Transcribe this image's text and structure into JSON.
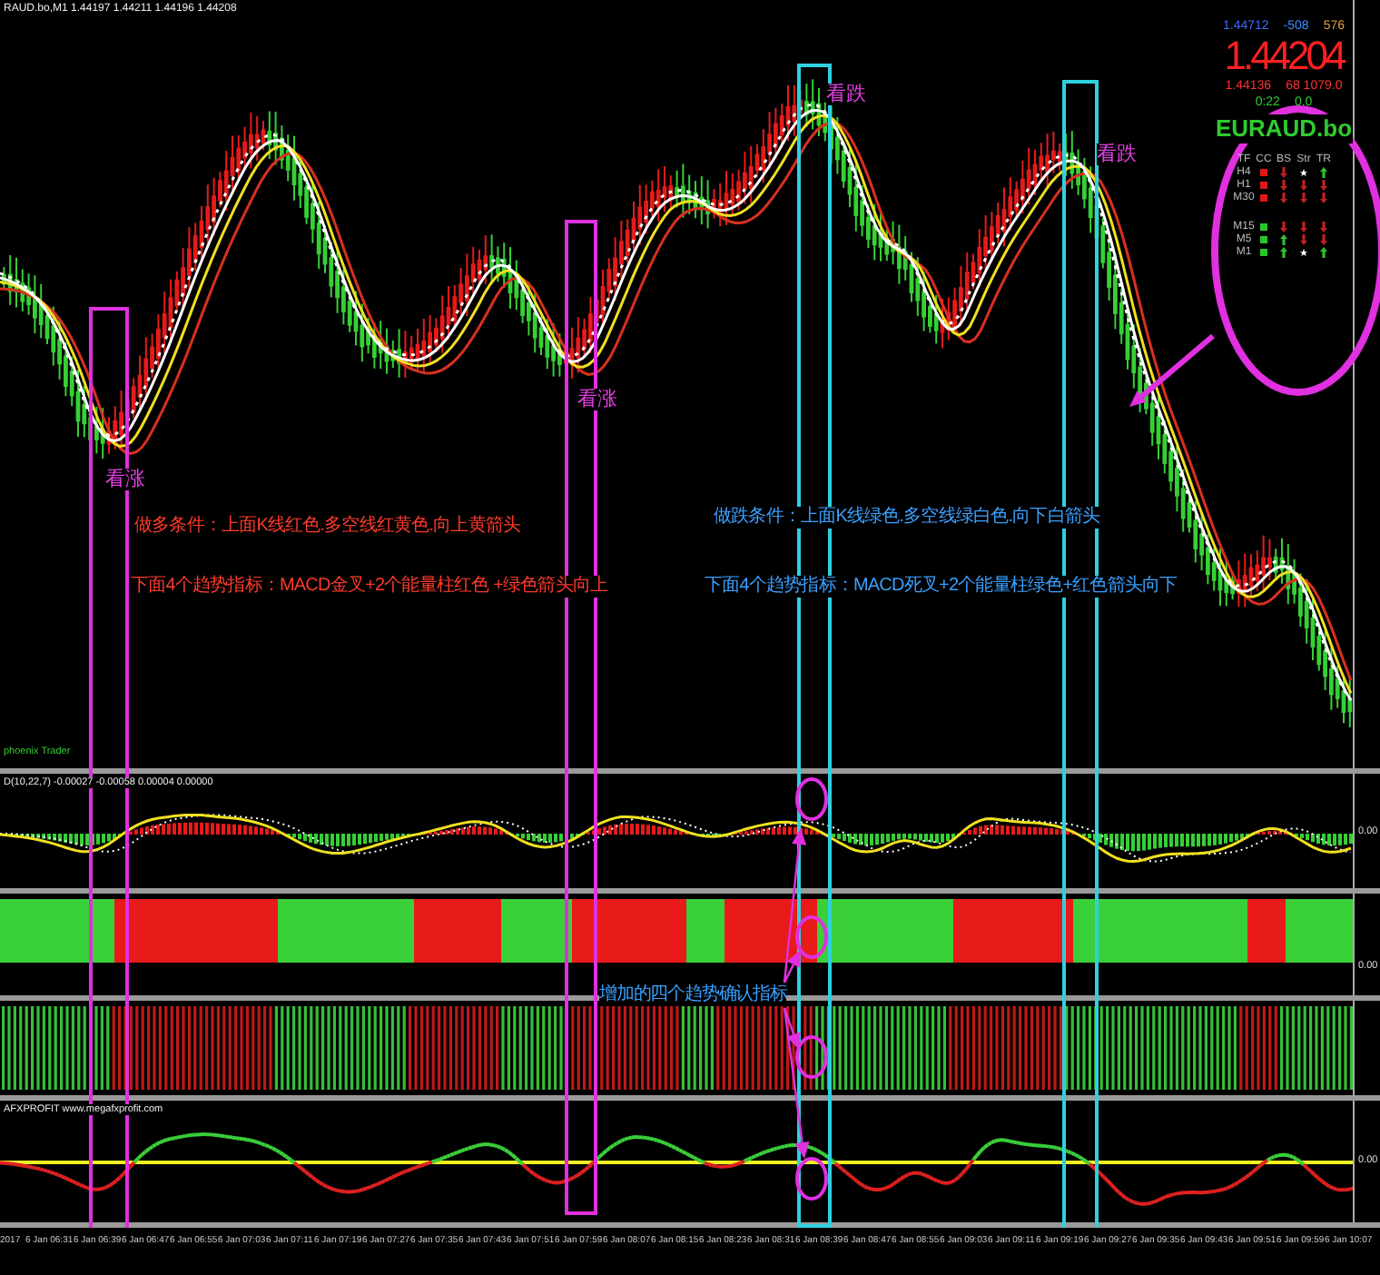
{
  "chart_header": {
    "title": "RAUD.bo,M1  1.44197 1.44211 1.44196 1.44208"
  },
  "info_panel": {
    "bid": "1.44712",
    "spread": "-508",
    "ticks": "576",
    "price": "1.44204",
    "low": "1.44136",
    "range": "68 1079.0",
    "timer": "0:22",
    "change": "0.0",
    "symbol": "EURAUD.bo",
    "columns": [
      "TF",
      "CC",
      "BS",
      "Str",
      "TR"
    ],
    "row_groups": [
      [
        {
          "tf": "H4",
          "cells": [
            {
              "kind": "square",
              "color": "#e01818"
            },
            {
              "kind": "down"
            },
            {
              "kind": "star"
            },
            {
              "kind": "up"
            }
          ]
        },
        {
          "tf": "H1",
          "cells": [
            {
              "kind": "square",
              "color": "#e01818"
            },
            {
              "kind": "down"
            },
            {
              "kind": "down"
            },
            {
              "kind": "down"
            }
          ]
        },
        {
          "tf": "M30",
          "cells": [
            {
              "kind": "square",
              "color": "#e01818"
            },
            {
              "kind": "down"
            },
            {
              "kind": "down"
            },
            {
              "kind": "down"
            }
          ]
        }
      ],
      [
        {
          "tf": "M15",
          "cells": [
            {
              "kind": "square",
              "color": "#28c828"
            },
            {
              "kind": "down"
            },
            {
              "kind": "down"
            },
            {
              "kind": "down"
            }
          ]
        },
        {
          "tf": "M5",
          "cells": [
            {
              "kind": "square",
              "color": "#28c828"
            },
            {
              "kind": "up"
            },
            {
              "kind": "down"
            },
            {
              "kind": "down"
            }
          ]
        },
        {
          "tf": "M1",
          "cells": [
            {
              "kind": "square",
              "color": "#28c828"
            },
            {
              "kind": "up"
            },
            {
              "kind": "star"
            },
            {
              "kind": "up"
            }
          ]
        }
      ]
    ]
  },
  "signals": [
    "看涨",
    "看涨",
    "看跌",
    "看跌"
  ],
  "notes": [
    {
      "kind": "long",
      "lines": [
        "做多条件：上面K线红色.多空线红黄色.向上黄箭头",
        "下面4个趋势指标：MACD金叉+2个能量柱红色 +绿色箭头向上"
      ]
    },
    {
      "kind": "short",
      "lines": [
        "做跌条件：上面K线绿色.多空线绿白色.向下白箭头",
        "下面4个趋势指标：MACD死叉+2个能量柱绿色+红色箭头向下"
      ]
    }
  ],
  "indicator_note": "增加的四个趋势确认指标",
  "footer_label": "phoenix Trader",
  "frames": [
    {
      "color": "#e030e0"
    },
    {
      "color": "#e030e0"
    },
    {
      "color": "#30d0e0"
    },
    {
      "color": "#30d0e0"
    }
  ],
  "macd_panel": {
    "label": "D(10,22,7) -0.00027 -0.00058 0.00004 0.00000",
    "zero": "0.00"
  },
  "trend_panel": {
    "zero": "0.00"
  },
  "oscillator_panel": {
    "label": "AFXPROFIT  www.megafxprofit.com",
    "zero": "0.00"
  },
  "time_axis": [
    "2017",
    "6 Jan 06:31",
    "6 Jan 06:39",
    "6 Jan 06:47",
    "6 Jan 06:55",
    "6 Jan 07:03",
    "6 Jan 07:11",
    "6 Jan 07:19",
    "6 Jan 07:27",
    "6 Jan 07:35",
    "6 Jan 07:43",
    "6 Jan 07:51",
    "6 Jan 07:59",
    "6 Jan 08:07",
    "6 Jan 08:15",
    "6 Jan 08:23",
    "6 Jan 08:31",
    "6 Jan 08:39",
    "6 Jan 08:47",
    "6 Jan 08:55",
    "6 Jan 09:03",
    "6 Jan 09:11",
    "6 Jan 09:19",
    "6 Jan 09:27",
    "6 Jan 09:35",
    "6 Jan 09:43",
    "6 Jan 09:51",
    "6 Jan 09:59",
    "6 Jan 10:07"
  ]
}
